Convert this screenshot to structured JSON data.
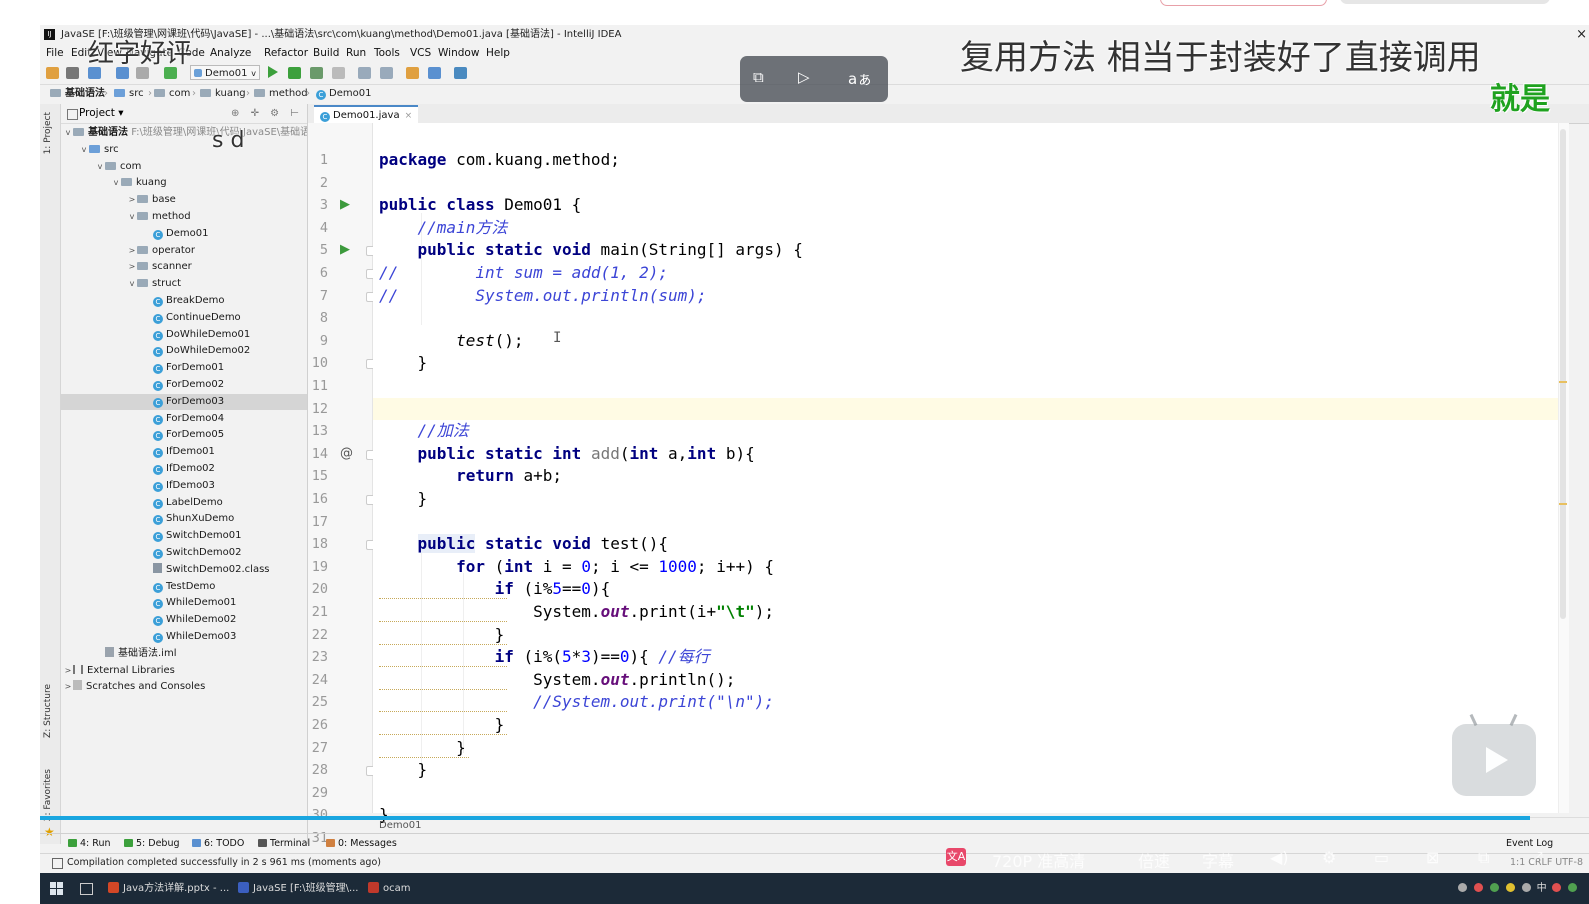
{
  "window": {
    "title": "JavaSE [F:\\班级管理\\网课班\\代码\\JavaSE] - ...\\基础语法\\src\\com\\kuang\\method\\Demo01.java [基础语法] - IntelliJ IDEA",
    "close": "×"
  },
  "menu": [
    "File",
    "Edit",
    "View",
    "Navigate",
    "Code",
    "Analyze",
    "Refactor",
    "Build",
    "Run",
    "Tools",
    "VCS",
    "Window",
    "Help"
  ],
  "toolbar": {
    "run_config": "Demo01"
  },
  "breadcrumb": [
    "基础语法",
    "src",
    "com",
    "kuang",
    "method",
    "Demo01"
  ],
  "tool_windows": {
    "project": "1: Project",
    "structure": "Z: Structure",
    "favorites": "2: Favorites"
  },
  "project": {
    "title": "Project",
    "root_label": "基础语法",
    "root_path": "F:\\班级管理\\网课班\\代码\\JavaSE\\基础语法",
    "tree": [
      {
        "label": "src",
        "indent": 1,
        "arrow": "v",
        "icon": "folder-src"
      },
      {
        "label": "com",
        "indent": 2,
        "arrow": "v",
        "icon": "package"
      },
      {
        "label": "kuang",
        "indent": 3,
        "arrow": "v",
        "icon": "package"
      },
      {
        "label": "base",
        "indent": 4,
        "arrow": ">",
        "icon": "package"
      },
      {
        "label": "method",
        "indent": 4,
        "arrow": "v",
        "icon": "package"
      },
      {
        "label": "Demo01",
        "indent": 5,
        "arrow": "",
        "icon": "class"
      },
      {
        "label": "operator",
        "indent": 4,
        "arrow": ">",
        "icon": "package"
      },
      {
        "label": "scanner",
        "indent": 4,
        "arrow": ">",
        "icon": "package"
      },
      {
        "label": "struct",
        "indent": 4,
        "arrow": "v",
        "icon": "package"
      },
      {
        "label": "BreakDemo",
        "indent": 5,
        "arrow": "",
        "icon": "class"
      },
      {
        "label": "ContinueDemo",
        "indent": 5,
        "arrow": "",
        "icon": "class"
      },
      {
        "label": "DoWhileDemo01",
        "indent": 5,
        "arrow": "",
        "icon": "class"
      },
      {
        "label": "DoWhileDemo02",
        "indent": 5,
        "arrow": "",
        "icon": "class"
      },
      {
        "label": "ForDemo01",
        "indent": 5,
        "arrow": "",
        "icon": "class"
      },
      {
        "label": "ForDemo02",
        "indent": 5,
        "arrow": "",
        "icon": "class"
      },
      {
        "label": "ForDemo03",
        "indent": 5,
        "arrow": "",
        "icon": "class",
        "selected": true
      },
      {
        "label": "ForDemo04",
        "indent": 5,
        "arrow": "",
        "icon": "class"
      },
      {
        "label": "ForDemo05",
        "indent": 5,
        "arrow": "",
        "icon": "class"
      },
      {
        "label": "IfDemo01",
        "indent": 5,
        "arrow": "",
        "icon": "class"
      },
      {
        "label": "IfDemo02",
        "indent": 5,
        "arrow": "",
        "icon": "class"
      },
      {
        "label": "IfDemo03",
        "indent": 5,
        "arrow": "",
        "icon": "class"
      },
      {
        "label": "LabelDemo",
        "indent": 5,
        "arrow": "",
        "icon": "class"
      },
      {
        "label": "ShunXuDemo",
        "indent": 5,
        "arrow": "",
        "icon": "class"
      },
      {
        "label": "SwitchDemo01",
        "indent": 5,
        "arrow": "",
        "icon": "class"
      },
      {
        "label": "SwitchDemo02",
        "indent": 5,
        "arrow": "",
        "icon": "class"
      },
      {
        "label": "SwitchDemo02.class",
        "indent": 5,
        "arrow": "",
        "icon": "classfile"
      },
      {
        "label": "TestDemo",
        "indent": 5,
        "arrow": "",
        "icon": "class"
      },
      {
        "label": "WhileDemo01",
        "indent": 5,
        "arrow": "",
        "icon": "class"
      },
      {
        "label": "WhileDemo02",
        "indent": 5,
        "arrow": "",
        "icon": "class"
      },
      {
        "label": "WhileDemo03",
        "indent": 5,
        "arrow": "",
        "icon": "class"
      },
      {
        "label": "基础语法.iml",
        "indent": 2,
        "arrow": "",
        "icon": "iml"
      },
      {
        "label": "External Libraries",
        "indent": 0,
        "arrow": ">",
        "icon": "library"
      },
      {
        "label": "Scratches and Consoles",
        "indent": 0,
        "arrow": ">",
        "icon": "scratch"
      }
    ]
  },
  "editor": {
    "tab": "Demo01.java",
    "current_line": 12,
    "footer_crumb": "Demo01",
    "lines": [
      [
        [
          "kw",
          "package"
        ],
        [
          "pl",
          " com.kuang.method;"
        ]
      ],
      [],
      [
        [
          "kw",
          "public class"
        ],
        [
          "pl",
          " Demo01 {"
        ]
      ],
      [
        [
          "pl",
          "    "
        ],
        [
          "cm",
          "//main方法"
        ]
      ],
      [
        [
          "pl",
          "    "
        ],
        [
          "kw",
          "public static void"
        ],
        [
          "pl",
          " main(String[] args) {"
        ]
      ],
      [
        [
          "cm",
          "//        int sum = add(1, 2);"
        ]
      ],
      [
        [
          "cm",
          "//        System.out.println(sum);"
        ]
      ],
      [],
      [
        [
          "pl",
          "        "
        ],
        [
          "it",
          "test"
        ],
        [
          "pl",
          "();"
        ]
      ],
      [
        [
          "pl",
          "    }"
        ]
      ],
      [],
      [],
      [
        [
          "pl",
          "    "
        ],
        [
          "cm",
          "//加法"
        ]
      ],
      [
        [
          "pl",
          "    "
        ],
        [
          "kw",
          "public static int"
        ],
        [
          "pl",
          " "
        ],
        [
          "gr",
          "add"
        ],
        [
          "pl",
          "("
        ],
        [
          "kw",
          "int"
        ],
        [
          "pl",
          " a,"
        ],
        [
          "kw",
          "int"
        ],
        [
          "pl",
          " b){"
        ]
      ],
      [
        [
          "pl",
          "        "
        ],
        [
          "kw",
          "return"
        ],
        [
          "pl",
          " a+b;"
        ]
      ],
      [
        [
          "pl",
          "    }"
        ]
      ],
      [],
      [
        [
          "pl",
          "    "
        ],
        [
          "kwh",
          "public"
        ],
        [
          "pl",
          " "
        ],
        [
          "kw",
          "static void"
        ],
        [
          "pl",
          " test(){"
        ]
      ],
      [
        [
          "pl",
          "        "
        ],
        [
          "kw",
          "for"
        ],
        [
          "pl",
          " ("
        ],
        [
          "kw",
          "int"
        ],
        [
          "pl",
          " i = "
        ],
        [
          "nm",
          "0"
        ],
        [
          "pl",
          "; i <= "
        ],
        [
          "nm",
          "1000"
        ],
        [
          "pl",
          "; i++) {"
        ]
      ],
      [
        [
          "pl",
          "            "
        ],
        [
          "kw",
          "if"
        ],
        [
          "pl",
          " (i%"
        ],
        [
          "nm",
          "5"
        ],
        [
          "pl",
          "=="
        ],
        [
          "nm",
          "0"
        ],
        [
          "pl",
          "){"
        ]
      ],
      [
        [
          "pl",
          "                System."
        ],
        [
          "fi",
          "out"
        ],
        [
          "pl",
          ".print(i+"
        ],
        [
          "st",
          "\"\\t\""
        ],
        [
          "pl",
          ");"
        ]
      ],
      [
        [
          "pl",
          "            }"
        ]
      ],
      [
        [
          "pl",
          "            "
        ],
        [
          "kw",
          "if"
        ],
        [
          "pl",
          " (i%("
        ],
        [
          "nm",
          "5"
        ],
        [
          "pl",
          "*"
        ],
        [
          "nm",
          "3"
        ],
        [
          "pl",
          ")=="
        ],
        [
          "nm",
          "0"
        ],
        [
          "pl",
          "){ "
        ],
        [
          "cm",
          "//每行"
        ]
      ],
      [
        [
          "pl",
          "                System."
        ],
        [
          "fi",
          "out"
        ],
        [
          "pl",
          ".println();"
        ]
      ],
      [
        [
          "pl",
          "                "
        ],
        [
          "cm",
          "//System.out.print(\"\\n\");"
        ]
      ],
      [
        [
          "pl",
          "            }"
        ]
      ],
      [
        [
          "pl",
          "        }"
        ]
      ],
      [
        [
          "pl",
          "    }"
        ]
      ],
      [],
      [
        [
          "pl",
          "}"
        ]
      ],
      []
    ]
  },
  "bottom_tabs": [
    "4: Run",
    "5: Debug",
    "6: TODO",
    "Terminal",
    "0: Messages"
  ],
  "event_log": "Event Log",
  "status": {
    "message": "Compilation completed successfully in 2 s 961 ms (moments ago)",
    "right": "1:1  CRLF  UTF-8"
  },
  "taskbar": {
    "items": [
      {
        "label": "Java方法详解.pptx - ...",
        "color": "#d24726"
      },
      {
        "label": "JavaSE [F:\\班级管理\\...",
        "color": "#3b5fc0"
      },
      {
        "label": "ocam",
        "color": "#c0392b"
      }
    ],
    "tray": "中"
  },
  "overlays": {
    "subtitle_main": "复用方法    相当于封装好了直接调用",
    "subtitle_green": "就是",
    "danmaku": "红字好评",
    "small_letters": "s  d",
    "player_quality": "720P 准高清",
    "player_speed": "倍速",
    "player_subtitle": "字幕"
  },
  "colors": {
    "keyword": "#000080",
    "comment": "#3c45d6",
    "number": "#0000ff",
    "string": "#008000",
    "field": "#660e7a",
    "accent": "#1aa6e0"
  }
}
